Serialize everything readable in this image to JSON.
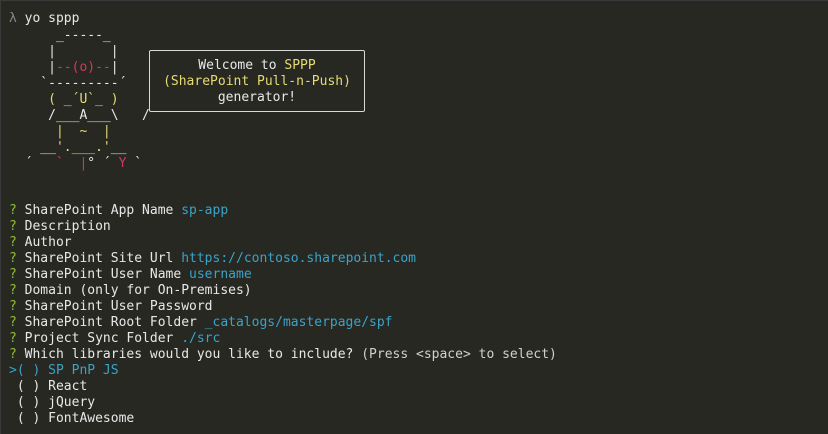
{
  "terminal": {
    "prompt_symbol": "λ",
    "command": "yo sppp"
  },
  "banner": {
    "line1_prefix": "Welcome to ",
    "line1_brand": "SPPP",
    "line2": "(SharePoint Pull-n-Push)",
    "line3": "generator!"
  },
  "questions": [
    {
      "mark": "?",
      "label": "SharePoint App Name",
      "answer": "sp-app"
    },
    {
      "mark": "?",
      "label": "Description",
      "answer": ""
    },
    {
      "mark": "?",
      "label": "Author",
      "answer": ""
    },
    {
      "mark": "?",
      "label": "SharePoint Site Url",
      "answer": "https://contoso.sharepoint.com"
    },
    {
      "mark": "?",
      "label": "SharePoint User Name",
      "answer": "username"
    },
    {
      "mark": "?",
      "label": "Domain (only for On-Premises)",
      "answer": ""
    },
    {
      "mark": "?",
      "label": "SharePoint User Password",
      "answer": ""
    },
    {
      "mark": "?",
      "label": "SharePoint Root Folder",
      "answer": "_catalogs/masterpage/spf"
    },
    {
      "mark": "?",
      "label": "Project Sync Folder",
      "answer": "./src"
    },
    {
      "mark": "?",
      "label": "Which libraries would you like to include?",
      "answer": "",
      "hint": "(Press <space> to select)"
    }
  ],
  "libraries": {
    "cursor": ">",
    "checkbox": "( )",
    "options": [
      "SP PnP JS",
      "React",
      "jQuery",
      "FontAwesome"
    ]
  },
  "colors": {
    "background": "#272822",
    "question_mark": "#8fbe2a",
    "answer": "#3aa3c9",
    "brand": "#e6db74",
    "art_red": "#d13a5a"
  }
}
